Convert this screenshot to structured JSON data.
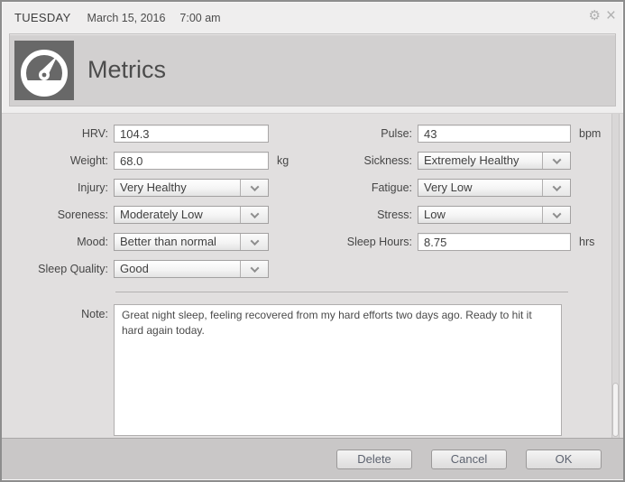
{
  "titlebar": {
    "weekday": "TUESDAY",
    "date": "March 15, 2016",
    "time": "7:00 am",
    "gear_icon": "⚙",
    "close_icon": "×"
  },
  "header": {
    "title": "Metrics",
    "icon": "gauge-icon"
  },
  "form": {
    "left": [
      {
        "label": "HRV:",
        "control": "input",
        "value": "104.3",
        "unit": ""
      },
      {
        "label": "Weight:",
        "control": "input",
        "value": "68.0",
        "unit": "kg"
      },
      {
        "label": "Injury:",
        "control": "select",
        "value": "Very Healthy"
      },
      {
        "label": "Soreness:",
        "control": "select",
        "value": "Moderately Low"
      },
      {
        "label": "Mood:",
        "control": "select",
        "value": "Better than normal"
      },
      {
        "label": "Sleep Quality:",
        "control": "select",
        "value": "Good"
      }
    ],
    "right": [
      {
        "label": "Pulse:",
        "control": "input",
        "value": "43",
        "unit": "bpm"
      },
      {
        "label": "Sickness:",
        "control": "select",
        "value": "Extremely Healthy"
      },
      {
        "label": "Fatigue:",
        "control": "select",
        "value": "Very Low"
      },
      {
        "label": "Stress:",
        "control": "select",
        "value": "Low"
      },
      {
        "label": "Sleep Hours:",
        "control": "input",
        "value": "8.75",
        "unit": "hrs"
      }
    ],
    "note": {
      "label": "Note:",
      "value": "Great night sleep, feeling recovered from my hard efforts two days ago. Ready to hit it hard again today."
    }
  },
  "footer": {
    "buttons": [
      {
        "label": "Delete"
      },
      {
        "label": "Cancel"
      },
      {
        "label": "OK"
      }
    ]
  },
  "colors": {
    "banner_icon_bg": "#686868",
    "form_bg": "#e1dfdf",
    "bottom_bar_bg": "#c9c7c7",
    "button_text": "#5d6370"
  }
}
